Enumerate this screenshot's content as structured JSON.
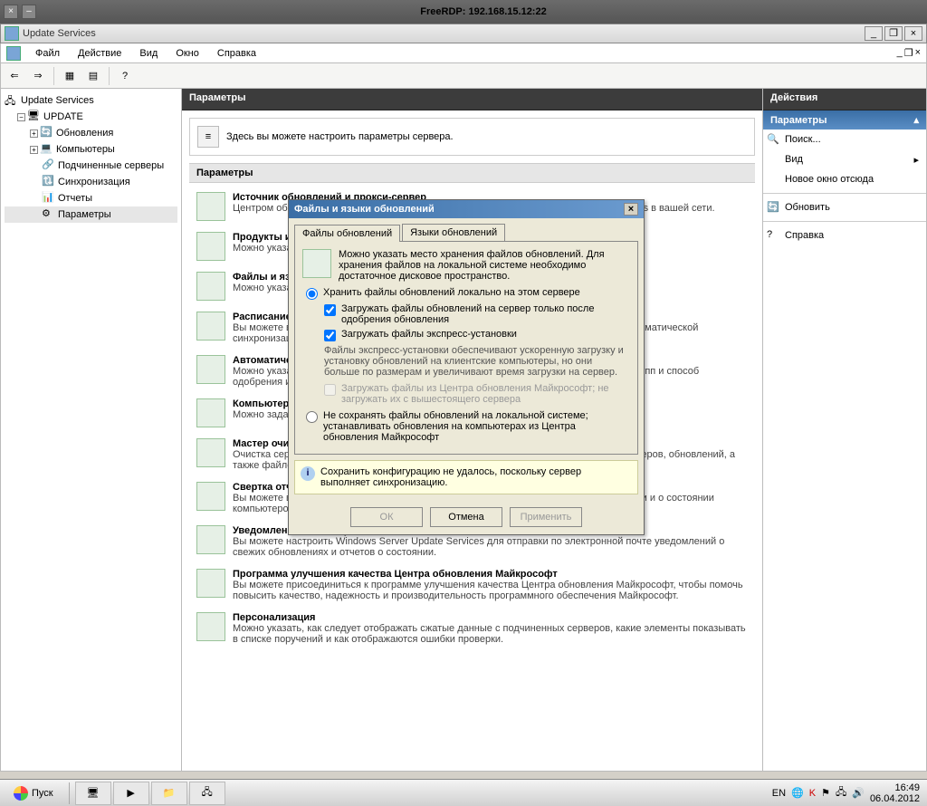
{
  "outerWindow": {
    "title": "FreeRDP: 192.168.15.12:22"
  },
  "mmcWindow": {
    "title": "Update Services"
  },
  "menu": {
    "file": "Файл",
    "action": "Действие",
    "view": "Вид",
    "window": "Окно",
    "help": "Справка"
  },
  "tree": {
    "root": "Update Services",
    "server": "UPDATE",
    "nodes": {
      "updates": "Обновления",
      "computers": "Компьютеры",
      "downstream": "Подчиненные серверы",
      "sync": "Синхронизация",
      "reports": "Отчеты",
      "options": "Параметры"
    }
  },
  "center": {
    "title": "Параметры",
    "intro": "Здесь вы можете настроить параметры сервера.",
    "groupTitle": "Параметры",
    "items": [
      {
        "title": "Источник обновлений и прокси-сервер",
        "desc": "Центром обновления Майкрософт или с вышестоящего сервера Windows Server Services в вашей сети."
      },
      {
        "title": "Продукты и классы",
        "desc": "Можно указать продукты и классы обновлений."
      },
      {
        "title": "Файлы и языки обновлений",
        "desc": "Можно указать место загрузки файлов обновлений и выбрать языки обновлений."
      },
      {
        "title": "Расписание синхронизации",
        "desc": "Вы можете выполнять синхронизацию вручную или задать расписание ежедневной автоматической синхронизации."
      },
      {
        "title": "Автоматические одобрения",
        "desc": "Можно указать автоматическое одобрение установки обновлений для определенных групп и способ одобрения изменений в существующих обновлениях."
      },
      {
        "title": "Компьютеры",
        "desc": "Можно задать способ назначения компьютеров группам."
      },
      {
        "title": "Мастер очистки сервера",
        "desc": "Очистка сервера позволяет освободить место на диске за счет очистки старых компьютеров, обновлений, а также файлов обновлений."
      },
      {
        "title": "Свертка отчетов",
        "desc": "Вы можете выбрать отправку с подчиненных серверов свернутых данных об обновлении и о состоянии компьютеров."
      },
      {
        "title": "Уведомления по электронной почте",
        "desc": "Вы можете настроить Windows Server Update Services для отправки по электронной почте уведомлений о свежих обновлениях и отчетов о состоянии."
      },
      {
        "title": "Программа улучшения качества Центра обновления Майкрософт",
        "desc": "Вы можете присоединиться к программе улучшения качества Центра обновления Майкрософт, чтобы помочь повысить качество, надежность и производительность программного обеспечения Майкрософт."
      },
      {
        "title": "Персонализация",
        "desc": "Можно указать, как следует отображать сжатые данные с подчиненных серверов, какие элементы показывать в списке поручений и как отображаются ошибки проверки."
      }
    ],
    "truncatedHint1": "синхронизацию с",
    "truncatedHint2": "е файлы и",
    "truncatedHint3": "евной",
    "truncatedHint4": "пределенных",
    "truncatedHint5": "овлениях, а",
    "truncatedHint6": "о состоянии"
  },
  "actions": {
    "title": "Действия",
    "category": "Параметры",
    "items": {
      "search": "Поиск...",
      "view": "Вид",
      "newWindow": "Новое окно отсюда",
      "refresh": "Обновить",
      "help": "Справка"
    }
  },
  "dialog": {
    "title": "Файлы и языки обновлений",
    "tabs": {
      "files": "Файлы обновлений",
      "langs": "Языки обновлений"
    },
    "intro": "Можно указать место хранения файлов обновлений. Для хранения файлов на локальной системе необходимо достаточное дисковое пространство.",
    "optStoreLocal": "Хранить файлы обновлений локально на этом сервере",
    "chkAfterApprove": "Загружать файлы обновлений на сервер только после одобрения обновления",
    "chkExpress": "Загружать файлы экспресс-установки",
    "descExpress": "Файлы экспресс-установки обеспечивают ускоренную загрузку и установку обновлений на клиентские компьютеры, но они больше по размерам и увеличивают время загрузки на сервер.",
    "chkFromMU": "Загружать файлы из Центра обновления Майкрософт; не загружать их с вышестоящего сервера",
    "optNoStore": "Не сохранять файлы обновлений на локальной системе; устанавливать обновления на компьютерах из Центра обновления Майкрософт",
    "info": "Сохранить конфигурацию не удалось, поскольку сервер выполняет синхронизацию.",
    "buttons": {
      "ok": "ОК",
      "cancel": "Отмена",
      "apply": "Применить"
    }
  },
  "taskbar": {
    "start": "Пуск",
    "lang": "EN",
    "time": "16:49",
    "date": "06.04.2012"
  }
}
